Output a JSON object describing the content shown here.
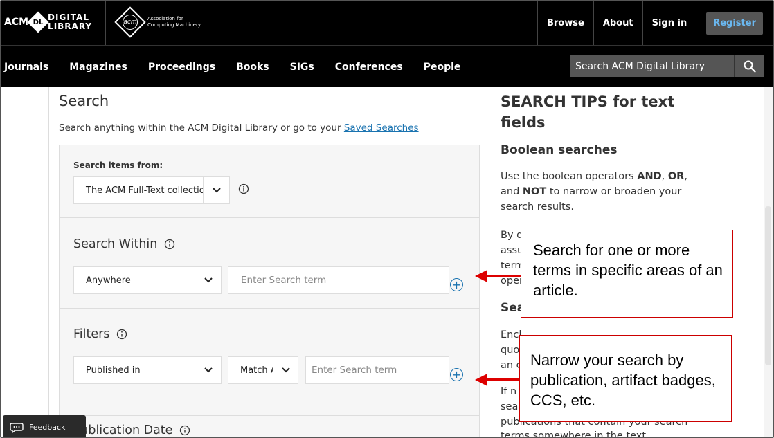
{
  "header": {
    "acm_text": "ACM",
    "dl_badge": "DL",
    "dl_line1": "DIGITAL",
    "dl_line2": "LIBRARY",
    "assoc_mark": "acm",
    "assoc_line1": "Association for",
    "assoc_line2": "Computing Machinery",
    "links": [
      "Browse",
      "About",
      "Sign in"
    ],
    "register_label": "Register",
    "register_color": "#6ab7ef"
  },
  "nav": {
    "items": [
      "Journals",
      "Magazines",
      "Proceedings",
      "Books",
      "SIGs",
      "Conferences",
      "People"
    ],
    "search_placeholder": "Search ACM Digital Library"
  },
  "main": {
    "title": "Search",
    "subtitle_text": "Search anything within the ACM Digital Library or go to your ",
    "saved_searches_link": "Saved Searches",
    "search_items_label": "Search items from:",
    "collection_value": "The ACM Full-Text collection",
    "search_within_title": "Search Within",
    "within_select_value": "Anywhere",
    "within_placeholder": "Enter Search term",
    "filters_title": "Filters",
    "filter_select_value": "Published in",
    "match_select_value": "Match All",
    "filter_placeholder": "Enter Search term",
    "pub_date_title": "Publication Date"
  },
  "tips": {
    "heading": "SEARCH TIPS for text fields",
    "boolean_title": "Boolean searches",
    "boolean_pre": "Use the boolean operators ",
    "op_and": "AND",
    "op_or": "OR",
    "boolean_mid": "and ",
    "op_not": "NOT",
    "boolean_post": " to narrow or broaden your search results.",
    "frag_by": "By d",
    "frag_assu": "assu",
    "frag_term": "term",
    "frag_oper": "oper",
    "frag_sea": "Sea",
    "frag_encl": "Encl",
    "frag_quo": "quo",
    "frag_an": "an e",
    "frag_ifn": "If n",
    "frag_sear": "sear",
    "frag_publications": "publications that contain your search",
    "frag_terms": "terms somewhere in the text"
  },
  "callouts": {
    "within": "Search for one or more terms in specific areas of an article.",
    "filters": "Narrow your search by publication, artifact badges, CCS, etc.",
    "color": "#cc0000"
  },
  "feedback_label": "Feedback"
}
